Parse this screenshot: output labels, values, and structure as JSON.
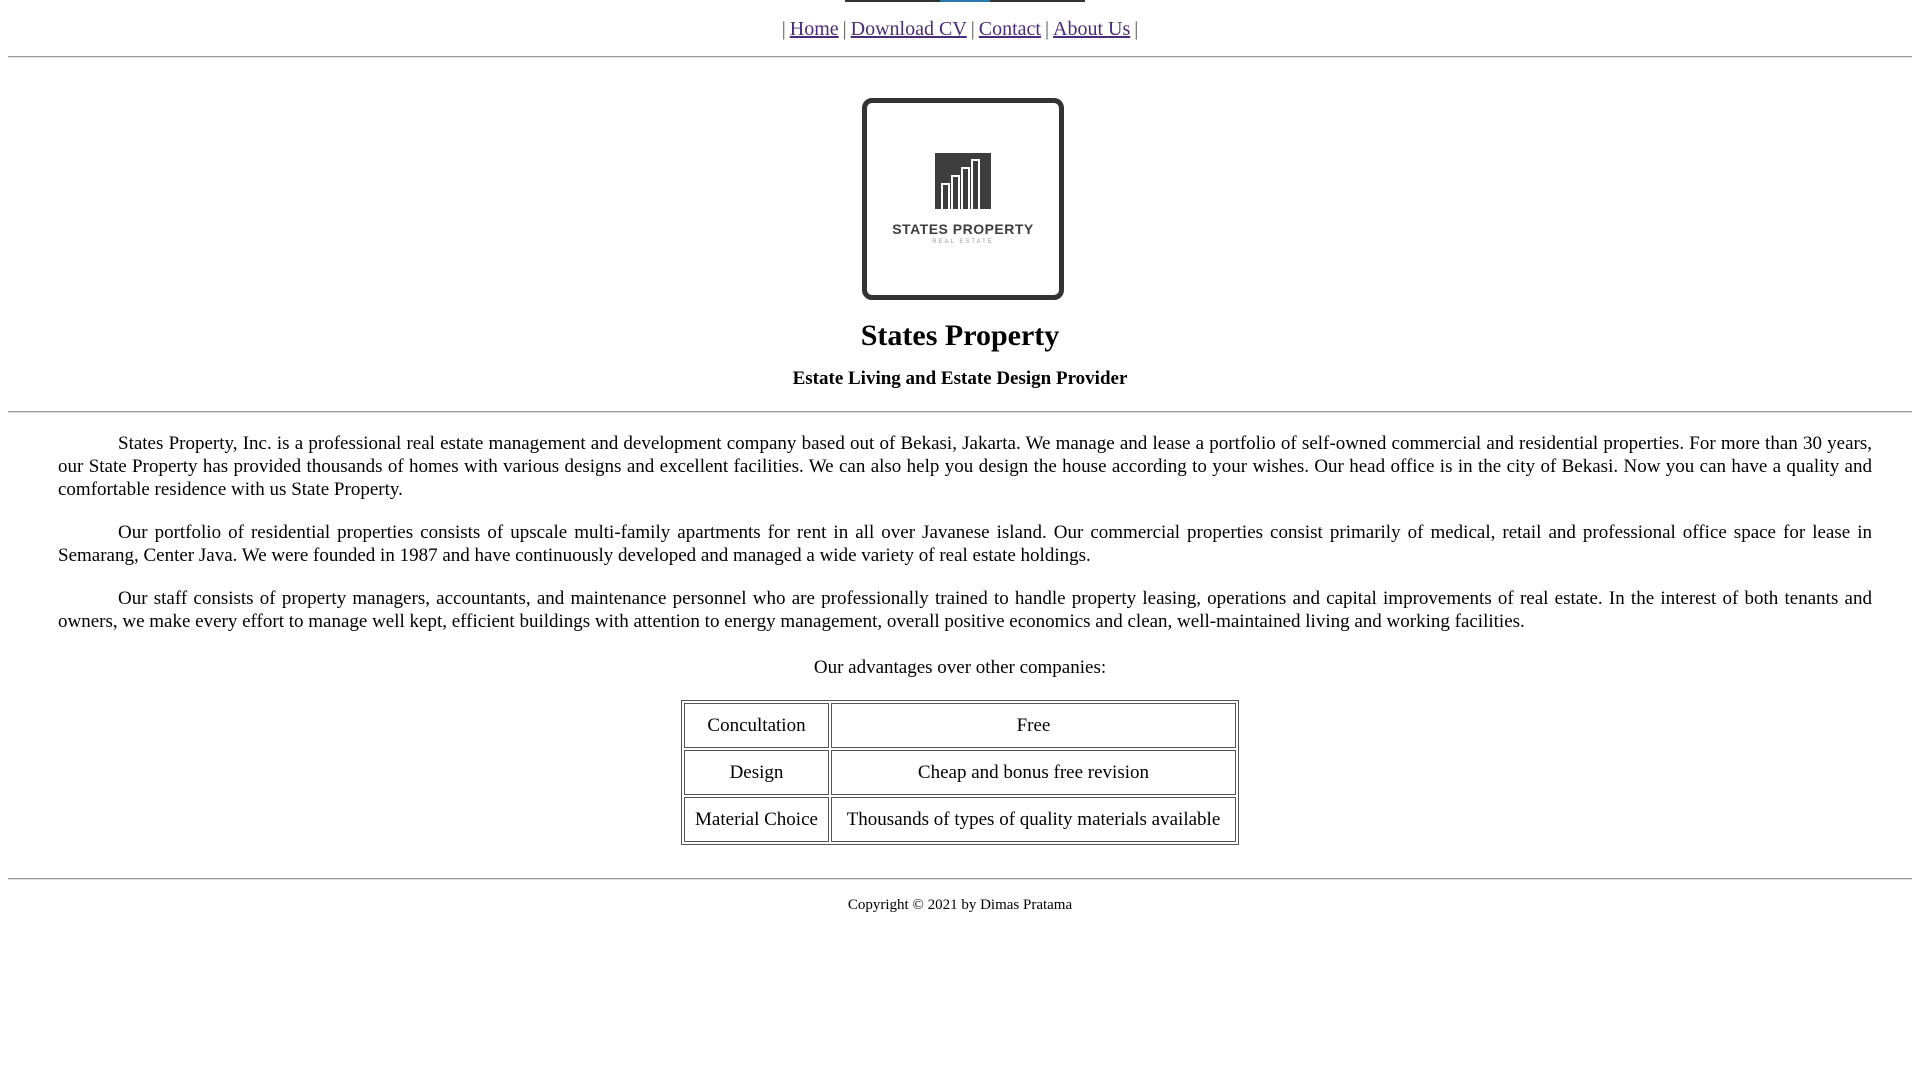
{
  "nav": {
    "links": [
      {
        "label": "Home"
      },
      {
        "label": "Download CV"
      },
      {
        "label": "Contact"
      },
      {
        "label": "About Us"
      }
    ],
    "separator": "|"
  },
  "logo": {
    "name": "STATES PROPERTY",
    "tagline": "REAL ESTATE"
  },
  "header": {
    "title": "States Property",
    "subtitle": "Estate Living and Estate Design Provider"
  },
  "content": {
    "paragraphs": [
      "States Property, Inc. is a professional real estate management and development company based out of Bekasi, Jakarta. We manage and lease a portfolio of self-owned commercial and residential properties. For more than 30 years, our State Property has provided thousands of homes with various designs and excellent facilities. We can also help you design the house according to your wishes. Our head office is in the city of Bekasi. Now you can have a quality and comfortable residence with us State Property.",
      "Our portfolio of residential properties consists of upscale multi-family apartments for rent in all over Javanese island. Our commercial properties consist primarily of medical, retail and professional office space for lease in Semarang, Center Java. We were founded in 1987 and have continuously developed and managed a wide variety of real estate holdings.",
      "Our staff consists of property managers, accountants, and maintenance personnel who are professionally trained to handle property leasing, operations and capital improvements of real estate. In the interest of both tenants and owners, we make every effort to manage well kept, efficient buildings with attention to energy management, overall positive economics and clean, well-maintained living and working facilities."
    ],
    "advantages_heading": "Our advantages over other companies:",
    "advantages": [
      {
        "feature": "Concultation",
        "detail": "Free"
      },
      {
        "feature": "Design",
        "detail": "Cheap and bonus free revision"
      },
      {
        "feature": "Material Choice",
        "detail": "Thousands of types of quality materials available"
      }
    ]
  },
  "footer": {
    "copyright": "Copyright © 2021 by Dimas Pratama"
  },
  "colors": {
    "link": "#4a2a7a",
    "logo_dark": "#3d3d3d",
    "rule": "#9a9a9a"
  }
}
